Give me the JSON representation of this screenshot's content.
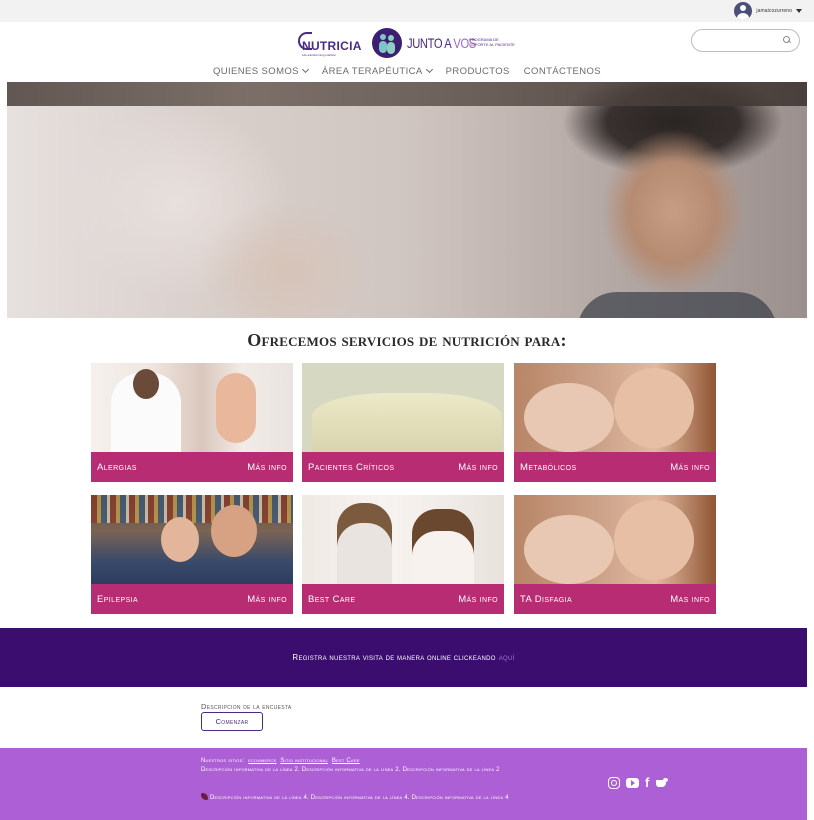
{
  "topbar": {
    "username": "jamaicozurreno"
  },
  "header": {
    "nutricia": {
      "name": "NUTRICIA",
      "tagline": "Life-transforming nutrition"
    },
    "junto": {
      "title_a": "JUNTO A",
      "title_b": "VOS",
      "subtitle": "PROGRAMA DE SOPORTE AL PACIENTE"
    },
    "search": {
      "placeholder": ""
    }
  },
  "nav": [
    {
      "label": "Quienes somos",
      "dropdown": true
    },
    {
      "label": "Área Terapéutica",
      "dropdown": true
    },
    {
      "label": "Productos",
      "dropdown": false
    },
    {
      "label": "Contáctenos",
      "dropdown": false
    }
  ],
  "services": {
    "title": "Ofrecemos servicios de nutrición para:",
    "cards": [
      {
        "label": "Alergias",
        "cta": "Más info",
        "image": "doctor-with-baby"
      },
      {
        "label": "Pacientes Críticos",
        "cta": "Más info",
        "image": "patient-in-bed"
      },
      {
        "label": "Metabólicos",
        "cta": "Más info",
        "image": "mother-with-baby"
      },
      {
        "label": "Epilepsia",
        "cta": "Más info",
        "image": "father-with-daughter"
      },
      {
        "label": "Best Care",
        "cta": "Más info",
        "image": "woman-with-girl"
      },
      {
        "label": "TA Disfagia",
        "cta": "Mas info",
        "image": "mother-with-baby"
      }
    ]
  },
  "register": {
    "text": "Registra nuestra visita de manera online clickeando",
    "link": "aquí"
  },
  "survey": {
    "label": "Descripcion de la encuesta",
    "button": "Comenzar"
  },
  "footer": {
    "sites_label": "Nuestros sitios:",
    "sites": [
      "ecommerce",
      "Sitio institucional",
      "Best Care"
    ],
    "desc_line2": "Descripción informativa de la línea 2. Descripción informativa de la línea 2. Descripción informativa de la línea 2",
    "desc_line4": "Descripción informativa de la línea 4. Descripción informativa de la línea 4. Descripción informativa de la línea 4",
    "socials": [
      "instagram-icon",
      "youtube-icon",
      "facebook-icon",
      "twitter-icon"
    ]
  },
  "colors": {
    "accent": "#b82c73",
    "brand_purple": "#3b0d6e",
    "footer": "#ad5fd6",
    "link": "#9a7ad8"
  }
}
